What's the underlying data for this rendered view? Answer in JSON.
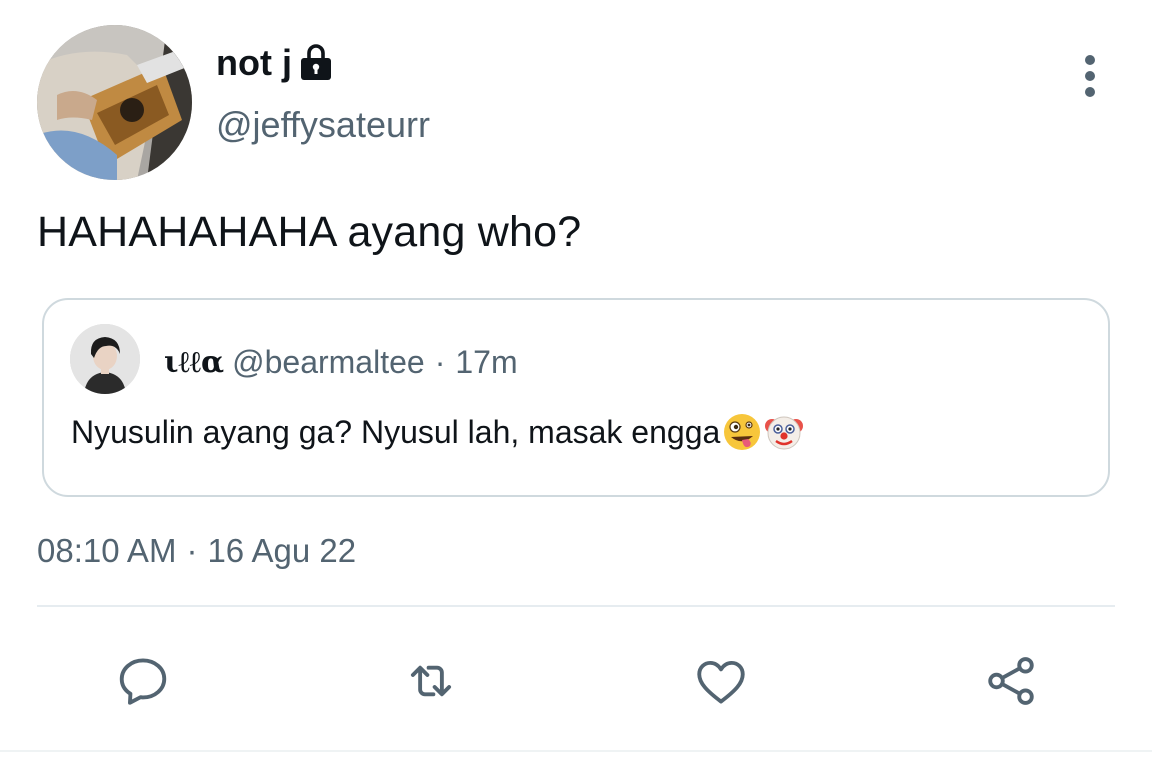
{
  "author": {
    "display_name": "not j",
    "handle": "@jeffysateurr",
    "protected": true
  },
  "tweet": {
    "text": "HAHAHAHAHA ayang who?"
  },
  "quoted": {
    "display_name": "ιℓℓα",
    "handle": "@bearmaltee",
    "separator": "·",
    "time": "17m",
    "text": "Nyusulin ayang ga? Nyusul lah, masak engga",
    "emojis": [
      "zany-face",
      "clown-face"
    ]
  },
  "meta": {
    "time": "08:10 AM",
    "separator": "·",
    "date": "16 Agu 22"
  },
  "actions": [
    "reply",
    "retweet",
    "like",
    "share"
  ],
  "colors": {
    "text": "#0f1419",
    "secondary": "#536471",
    "border": "#cfd9de",
    "divider": "#e6ecf0"
  }
}
